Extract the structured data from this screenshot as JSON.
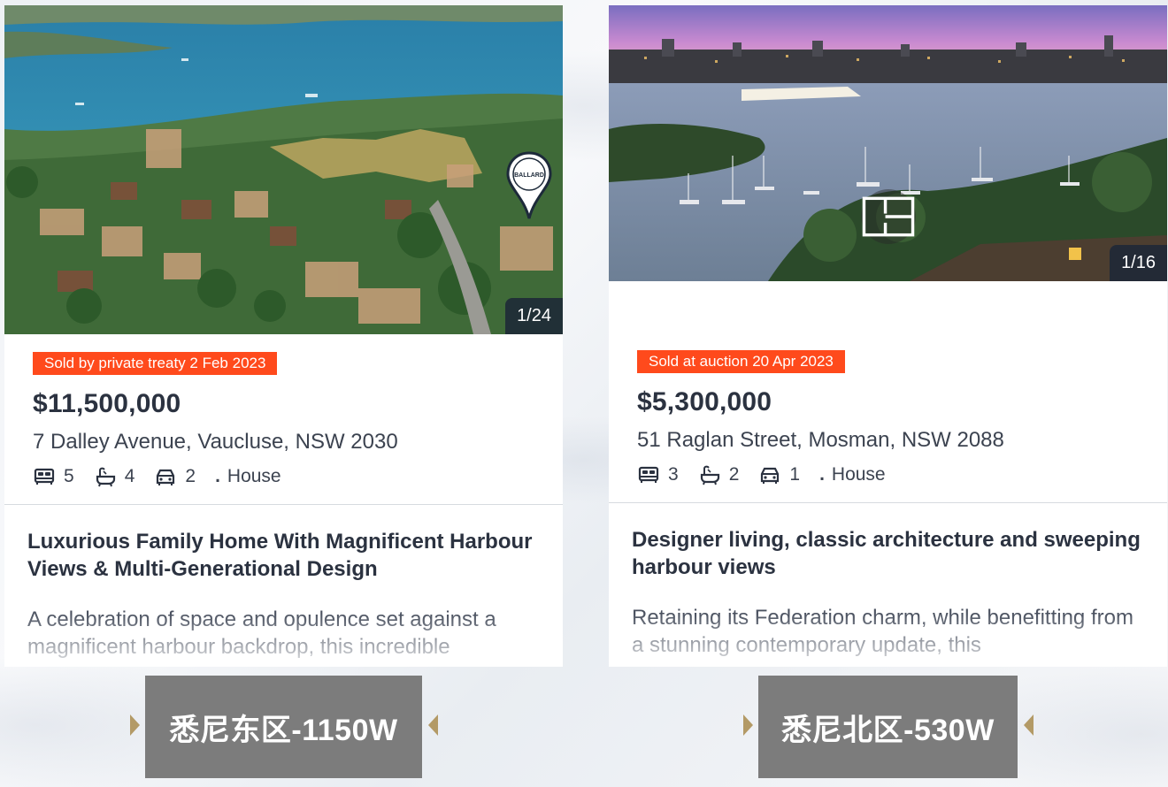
{
  "listings": [
    {
      "photo_counter": "1/24",
      "agency_pin_label": "BALLARD",
      "sold_badge": "Sold by private treaty 2 Feb 2023",
      "price": "$11,500,000",
      "address": "7 Dalley Avenue, Vaucluse, NSW 2030",
      "beds": "5",
      "baths": "4",
      "cars": "2",
      "property_type": "House",
      "headline": "Luxurious Family Home With Magnificent Harbour Views & Multi-Generational Design",
      "description": "A celebration of space and opulence set against a magnificent harbour backdrop, this incredible",
      "region_label": "悉尼东区-1150W"
    },
    {
      "photo_counter": "1/16",
      "sold_badge": "Sold at auction 20 Apr 2023",
      "price": "$5,300,000",
      "address": "51 Raglan Street, Mosman, NSW 2088",
      "beds": "3",
      "baths": "2",
      "cars": "1",
      "property_type": "House",
      "headline": "Designer living, classic architecture and sweeping harbour views",
      "description": "Retaining its Federation charm, while benefitting from a stunning contemporary update, this",
      "region_label": "悉尼北区-530W"
    }
  ],
  "separator_dot": ".",
  "icons": [
    "bed-icon",
    "bath-icon",
    "car-icon",
    "location-pin-icon",
    "floorplan-icon"
  ],
  "colors": {
    "badge": "#ff4a1c",
    "price_text": "#2b3240",
    "region_bar": "#7c7c7c",
    "arrow_gold": "#b39a66"
  }
}
